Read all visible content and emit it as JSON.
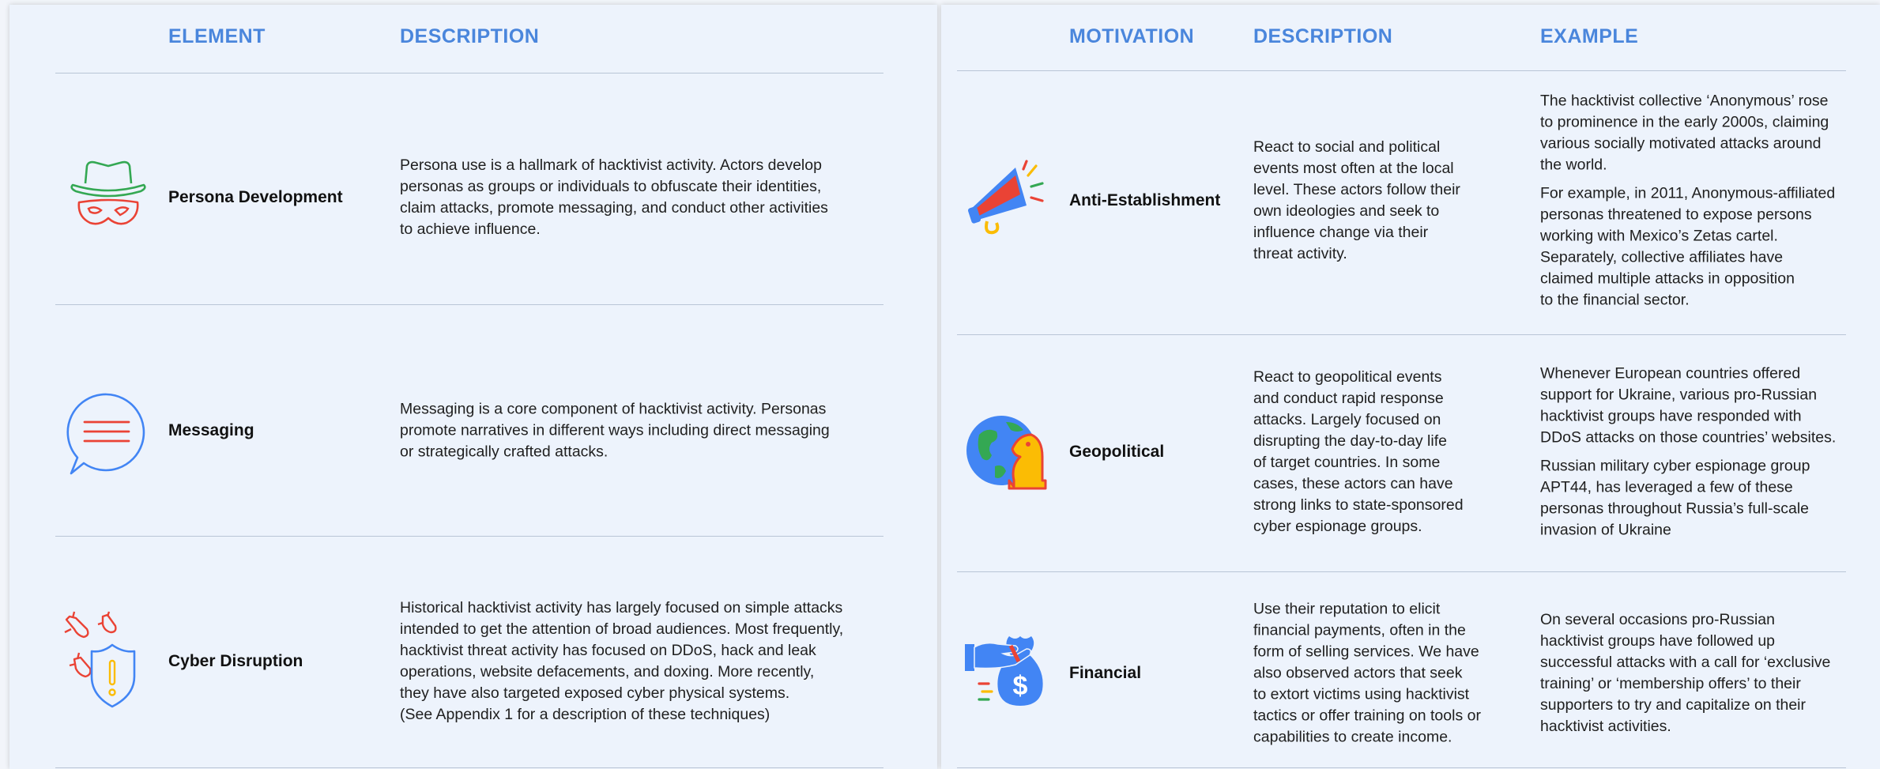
{
  "left_table": {
    "headers": {
      "element": "ELEMENT",
      "description": "DESCRIPTION"
    },
    "rows": [
      {
        "label": "Persona Development",
        "icon": "hat-mask-icon",
        "description": [
          "Persona use is a hallmark of hacktivist activity. Actors develop",
          "personas as groups or individuals to obfuscate their identities,",
          "claim attacks, promote messaging, and conduct other activities",
          "to achieve influence."
        ]
      },
      {
        "label": "Messaging",
        "icon": "speech-bubble-icon",
        "description": [
          "Messaging is a core component of hacktivist activity. Personas",
          "promote narratives in different ways including direct messaging",
          "or strategically crafted attacks."
        ]
      },
      {
        "label": "Cyber Disruption",
        "icon": "rockets-shield-icon",
        "description": [
          "Historical hacktivist activity has largely focused on simple attacks",
          "intended to get the attention of broad audiences. Most frequently,",
          "hacktivist threat activity has focused on DDoS, hack and leak",
          "operations, website defacements, and doxing. More recently,",
          "they have also targeted exposed cyber physical systems.",
          "(See Appendix 1 for a description of these techniques)"
        ]
      }
    ]
  },
  "right_table": {
    "headers": {
      "motivation": "MOTIVATION",
      "description": "DESCRIPTION",
      "example": "EXAMPLE"
    },
    "rows": [
      {
        "label": "Anti-Establishment",
        "icon": "megaphone-icon",
        "description": [
          "React to social and political",
          "events most often at the local",
          "level. These actors follow their",
          "own ideologies and seek to",
          "influence change via their",
          "threat activity."
        ],
        "example": [
          [
            "The hacktivist collective ‘Anonymous’ rose",
            "to prominence in the early 2000s, claiming",
            "various socially motivated attacks around",
            "the world."
          ],
          [
            "For example, in 2011, Anonymous-affiliated",
            "personas threatened to expose persons",
            "working with Mexico’s Zetas cartel.",
            "Separately, collective affiliates have",
            "claimed multiple attacks in opposition",
            "to the financial sector."
          ]
        ]
      },
      {
        "label": "Geopolitical",
        "icon": "globe-chess-knight-icon",
        "description": [
          "React to geopolitical events",
          "and conduct rapid response",
          "attacks. Largely focused on",
          "disrupting the day-to-day life",
          "of target countries. In some",
          "cases, these actors can have",
          "strong links to state-sponsored",
          "cyber espionage groups."
        ],
        "example": [
          [
            "Whenever European countries offered",
            "support for Ukraine, various pro-Russian",
            "hacktivist groups have responded with",
            "DDoS attacks on those countries’ websites."
          ],
          [
            "Russian military cyber espionage group",
            "APT44, has leveraged a few of these",
            "personas throughout Russia’s full-scale",
            "invasion of Ukraine"
          ]
        ]
      },
      {
        "label": "Financial",
        "icon": "hand-money-bag-icon",
        "description": [
          "Use their reputation to elicit",
          "financial payments, often in the",
          "form of selling services. We have",
          "also observed actors that seek",
          "to extort victims using hacktivist",
          "tactics or offer training on tools or",
          "capabilities to create income."
        ],
        "example": [
          [
            "On several occasions pro-Russian",
            "hacktivist groups have followed up",
            "successful attacks with a call for ‘exclusive",
            "training’ or ‘membership offers’ to their",
            "supporters to try and capitalize on their",
            "hacktivist activities."
          ]
        ]
      }
    ]
  },
  "colors": {
    "accent_blue": "#4a86dc",
    "icon_green": "#34a853",
    "icon_red": "#ea4335",
    "icon_blue": "#4285f4",
    "icon_yellow": "#fbbc04"
  }
}
